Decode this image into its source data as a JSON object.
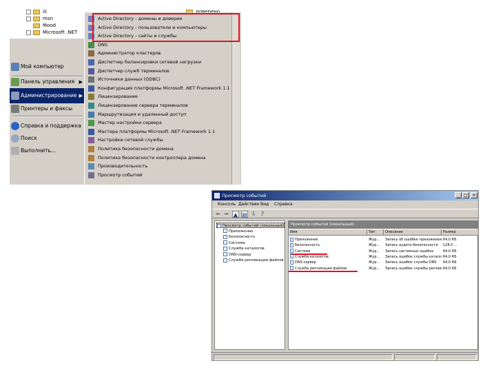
{
  "colors": {
    "highlight": "#e01020",
    "selection": "#0a246a",
    "menu_bg": "#d4d0c8"
  },
  "explorer": {
    "items": [
      "iii",
      "msn",
      "Mood",
      "Microsoft .NET"
    ],
    "right_item": "доверено"
  },
  "start_menu": {
    "left_items": [
      {
        "label": "Мой компьютер",
        "icon": "computer-icon"
      },
      {
        "label": "Панель управления",
        "icon": "control-panel-icon",
        "has_arrow": true
      },
      {
        "label": "Администрирование",
        "icon": "admin-tools-icon",
        "has_arrow": true,
        "active": true
      },
      {
        "label": "Принтеры и факсы",
        "icon": "printer-icon"
      },
      {
        "label": "Справка и поддержка",
        "icon": "help-icon"
      },
      {
        "label": "Поиск",
        "icon": "search-icon"
      },
      {
        "label": "Выполнить...",
        "icon": "run-icon"
      }
    ],
    "submenu_items": [
      "Active Directory - домены и доверие",
      "Active Directory - пользователи и компьютеры",
      "Active Directory - сайты и службы",
      "DNS",
      "Администратор кластеров",
      "Диспетчер балансировки сетевой нагрузки",
      "Диспетчер служб терминалов",
      "Источники данных (ODBC)",
      "Конфигурация платформы Microsoft .NET Framework 1.1",
      "Лицензирование",
      "Лицензирование сервера терминалов",
      "Маршрутизация и удаленный доступ",
      "Мастер настройки сервера",
      "Мастера платформы Microsoft .NET Framework 1.1",
      "Настройки сетевой службы",
      "Политика безопасности домена",
      "Политика безопасности контроллера домена",
      "Производительность",
      "Просмотр событий"
    ]
  },
  "event_viewer": {
    "title": "Просмотр событий",
    "menu": [
      "Консоль",
      "Действие",
      "Вид",
      "Справка"
    ],
    "tree": [
      "Просмотр событий (локальный)",
      "Приложение",
      "Безопасность",
      "Система",
      "Служба каталогов",
      "DNS-сервер",
      "Служба репликации файлов"
    ],
    "header": "Просмотр событий (локальный)",
    "columns": [
      "Имя",
      "Тип",
      "Описание",
      "Размер"
    ],
    "rows": [
      {
        "name": "Приложение",
        "type": "Жур...",
        "desc": "Запись об ошибке приложения",
        "size": "64,0 КБ"
      },
      {
        "name": "Безопасность",
        "type": "Жур...",
        "desc": "Запись аудита безопасности",
        "size": "128,0 ..."
      },
      {
        "name": "Система",
        "type": "Жур...",
        "desc": "Запись системных ошибок",
        "size": "64,0 КБ"
      },
      {
        "name": "Служба каталогов",
        "type": "Жур...",
        "desc": "Запись ошибок службы каталогов",
        "size": "64,0 КБ"
      },
      {
        "name": "DNS-сервер",
        "type": "Жур...",
        "desc": "Запись ошибок службы DNS",
        "size": "64,0 КБ"
      },
      {
        "name": "Служба репликации файлов",
        "type": "Жур...",
        "desc": "Запись ошибок службы репликации",
        "size": "64,0 КБ"
      }
    ]
  }
}
